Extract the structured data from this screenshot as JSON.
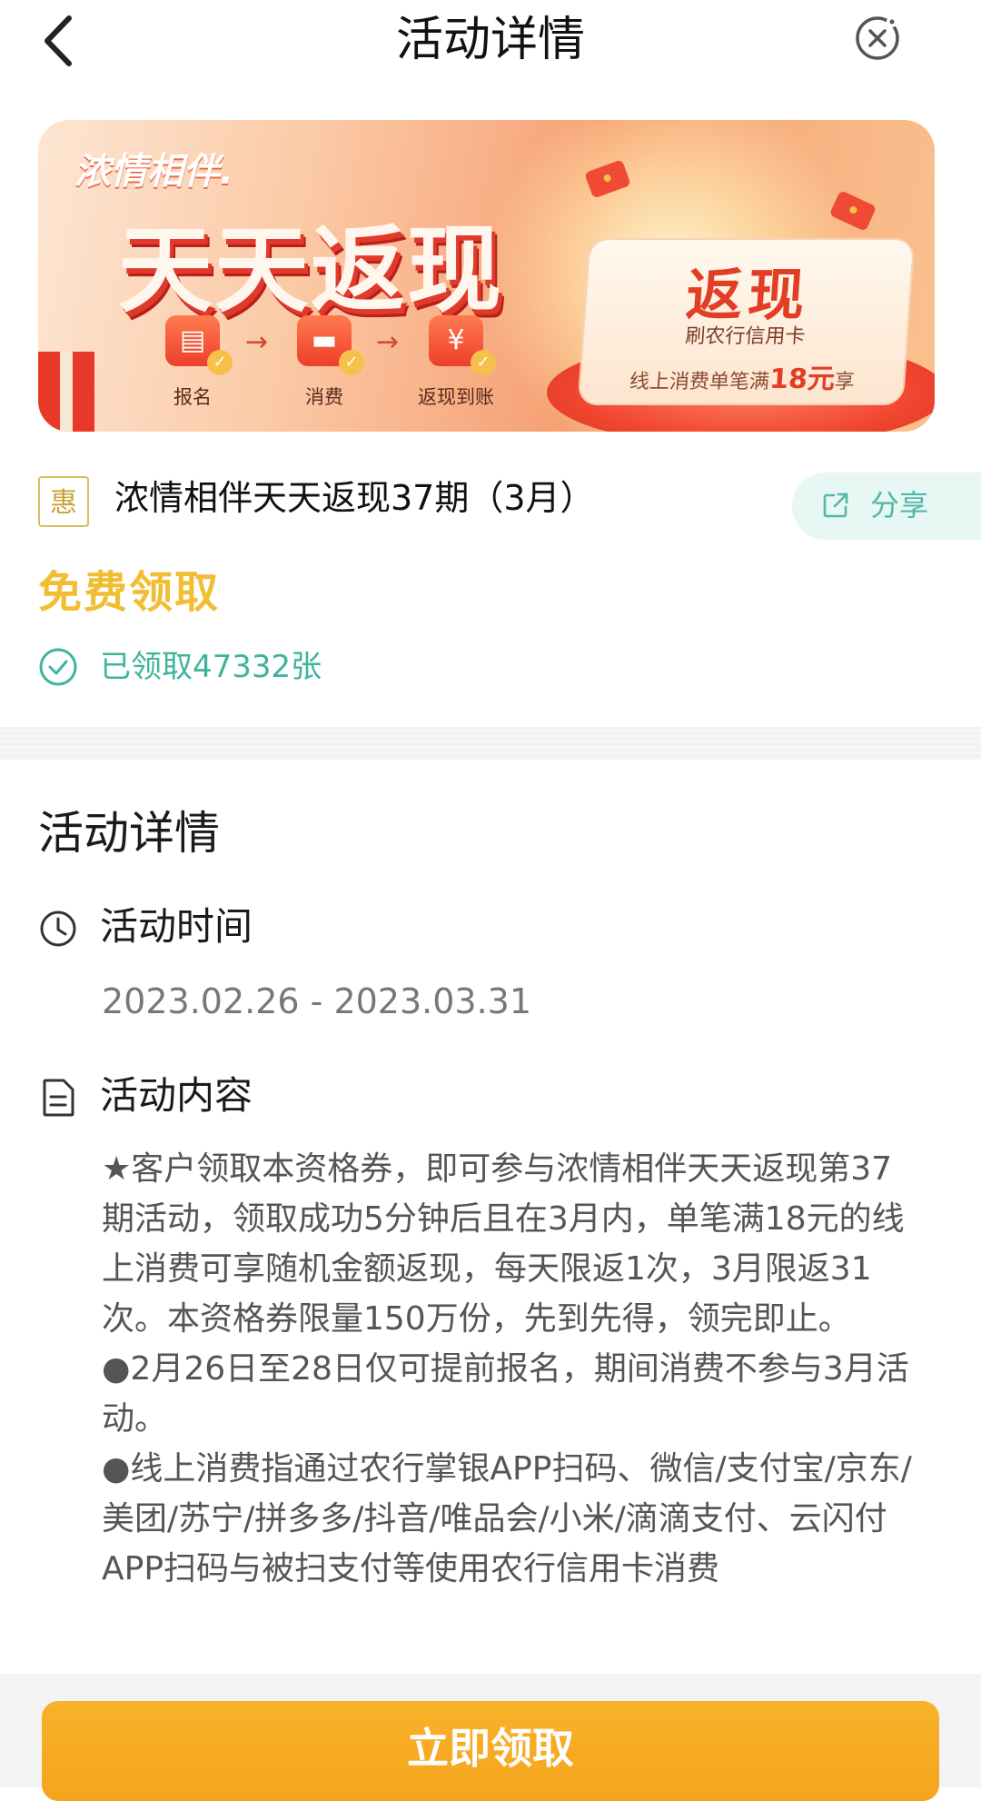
{
  "header": {
    "title": "活动详情"
  },
  "banner": {
    "brand": "浓情相伴.",
    "headline": "天天返现",
    "steps": [
      "报名",
      "消费",
      "返现到账"
    ],
    "cash_title": "返现",
    "cash_subtitle": "刷农行信用卡",
    "cash_footer_prefix": "线上消费单笔满",
    "cash_footer_amount": "18元",
    "cash_footer_suffix": "享"
  },
  "coupon": {
    "badge": "惠",
    "title": "浓情相伴天天返现37期（3月）",
    "share_label": "分享",
    "price_label": "免费领取",
    "claimed_text": "已领取47332张"
  },
  "details": {
    "section_title": "活动详情",
    "time_heading": "活动时间",
    "time_range": "2023.02.26 - 2023.03.31",
    "content_heading": "活动内容",
    "paragraphs": [
      "★客户领取本资格券，即可参与浓情相伴天天返现第37期活动，领取成功5分钟后且在3月内，单笔满18元的线上消费可享随机金额返现，每天限返1次，3月限返31次。本资格券限量150万份，先到先得，领完即止。",
      "●2月26日至28日仅可提前报名，期间消费不参与3月活动。",
      "●线上消费指通过农行掌银APP扫码、微信/支付宝/京东/美团/苏宁/拼多多/抖音/唯品会/小米/滴滴支付、云闪付APP扫码与被扫支付等使用农行信用卡消费"
    ]
  },
  "action": {
    "claim_label": "立即领取"
  },
  "colors": {
    "accent": "#f5a41d",
    "teal": "#3fb49d",
    "gold": "#f1be33"
  }
}
